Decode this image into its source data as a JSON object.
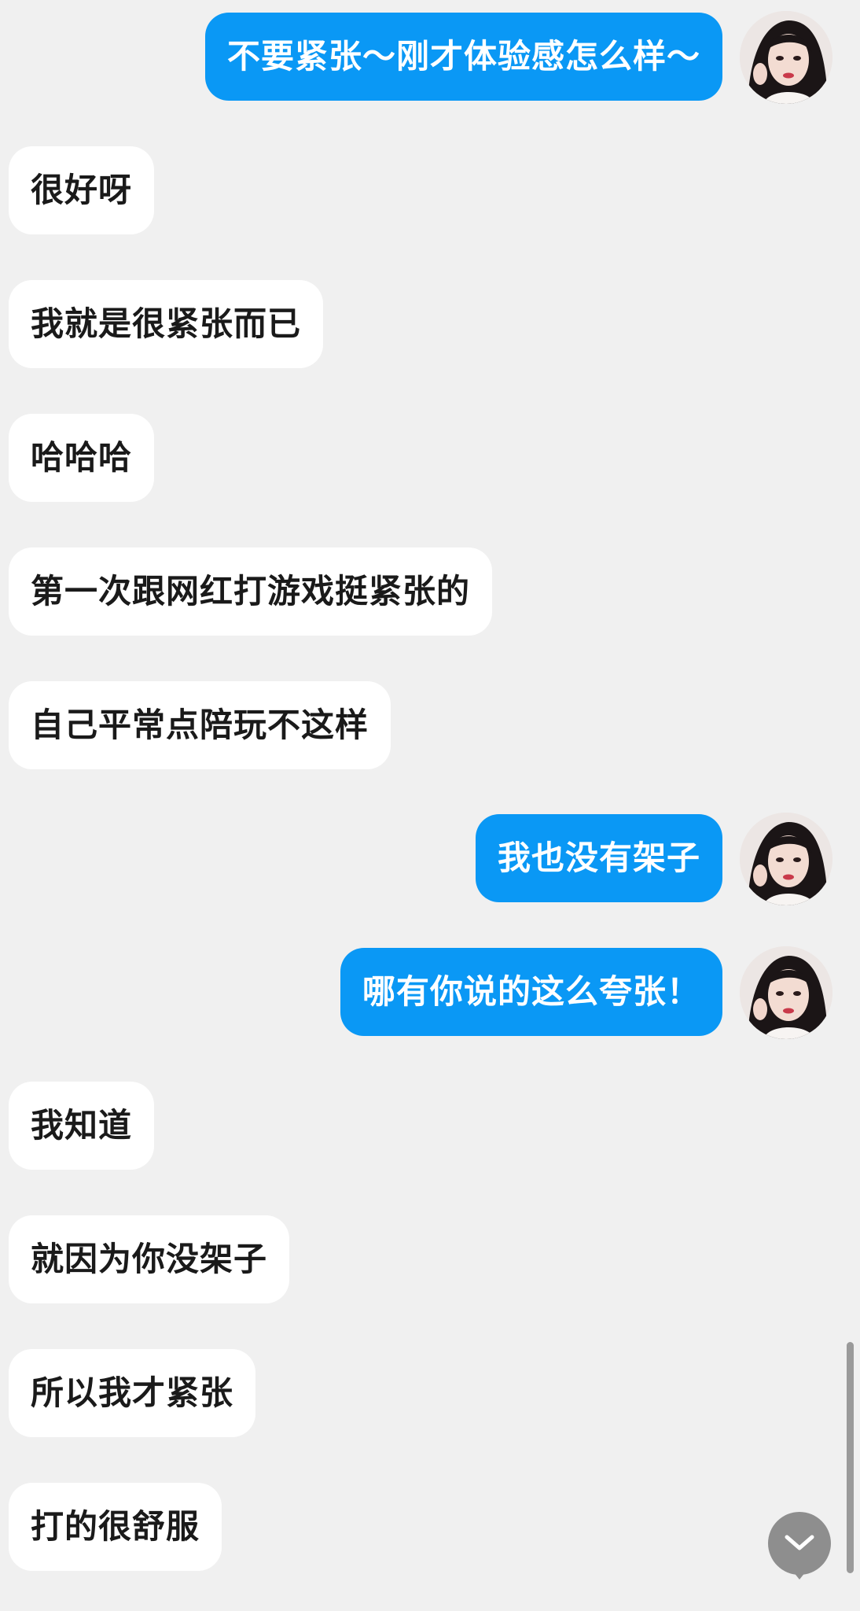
{
  "theme": {
    "background": "#f0f0f0",
    "incoming_bubble": "#ffffff",
    "outgoing_bubble": "#0a98f5",
    "outgoing_text": "#ffffff",
    "incoming_text": "#1a1a1a"
  },
  "messages": [
    {
      "direction": "out",
      "text": "不要紧张～刚才体验感怎么样～",
      "avatar": "user-avatar"
    },
    {
      "direction": "in",
      "text": "很好呀"
    },
    {
      "direction": "in",
      "text": "我就是很紧张而已"
    },
    {
      "direction": "in",
      "text": "哈哈哈"
    },
    {
      "direction": "in",
      "text": "第一次跟网红打游戏挺紧张的"
    },
    {
      "direction": "in",
      "text": "自己平常点陪玩不这样"
    },
    {
      "direction": "out",
      "text": "我也没有架子",
      "avatar": "user-avatar"
    },
    {
      "direction": "out",
      "text": "哪有你说的这么夸张！",
      "avatar": "user-avatar"
    },
    {
      "direction": "in",
      "text": "我知道"
    },
    {
      "direction": "in",
      "text": "就因为你没架子"
    },
    {
      "direction": "in",
      "text": "所以我才紧张"
    },
    {
      "direction": "in",
      "text": "打的很舒服"
    }
  ],
  "controls": {
    "scroll_down_icon": "chevron-down-icon"
  }
}
